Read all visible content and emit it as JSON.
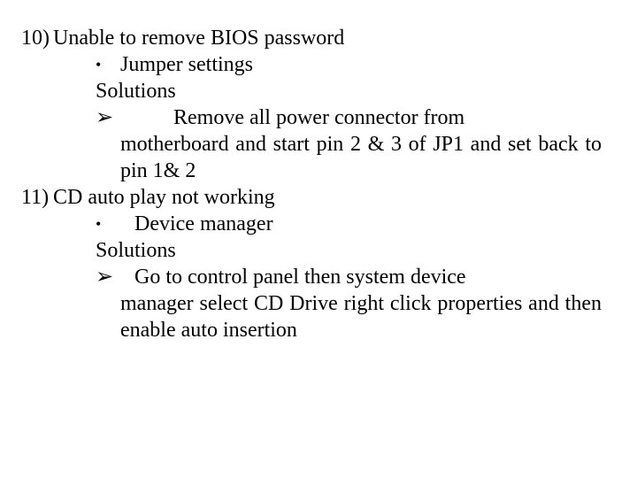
{
  "items": [
    {
      "num": "10)",
      "title": "Unable to remove BIOS password",
      "bullet": "•",
      "bullet_text": "Jumper settings",
      "solutions_label": "Solutions",
      "arrow": "➢",
      "solution_first": "Remove   all   power   connector   from",
      "solution_cont": "motherboard and start pin 2 & 3 of JP1 and set back to pin 1& 2"
    },
    {
      "num": "11)",
      "title": "CD auto play not working",
      "bullet": "•",
      "bullet_text": "Device manager",
      "solutions_label": "Solutions",
      "arrow": "➢",
      "solution_first": "Go  to  control  panel  then  system  device",
      "solution_cont": "manager select CD Drive right click properties and then enable auto insertion"
    }
  ]
}
